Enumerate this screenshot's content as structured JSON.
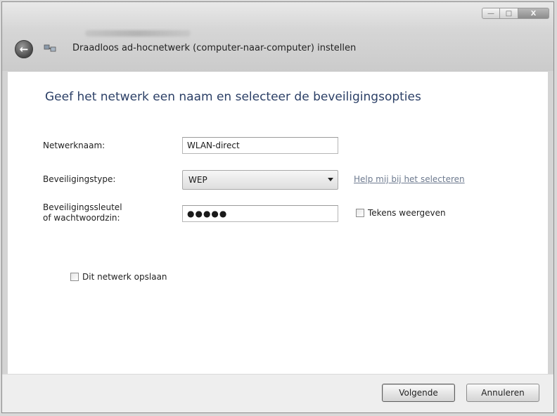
{
  "window": {
    "title": "Draadloos ad-hocnetwerk (computer-naar-computer) instellen",
    "controls": {
      "minimize": "—",
      "maximize": "□",
      "close": "X"
    }
  },
  "main": {
    "heading": "Geef het netwerk een naam en selecteer de beveiligingsopties",
    "network_name": {
      "label": "Netwerknaam:",
      "value": "WLAN-direct"
    },
    "security_type": {
      "label": "Beveiligingstype:",
      "value": "WEP",
      "help_link": "Help mij bij het selecteren"
    },
    "security_key": {
      "label_line1": "Beveiligingssleutel",
      "label_line2": "of wachtwoordzin:",
      "value": "●●●●●",
      "show_chars_label": "Tekens weergeven"
    },
    "save_network_label": "Dit netwerk opslaan"
  },
  "footer": {
    "next_label": "Volgende",
    "cancel_label": "Annuleren"
  }
}
